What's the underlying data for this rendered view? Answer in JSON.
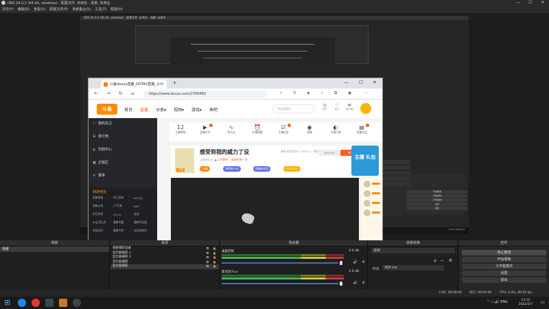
{
  "obs": {
    "title": "OBS 24.0.3 (64-bit, windows) - 配置文件: 未命名 - 场景: 未命名",
    "menu": [
      "文件(F)",
      "编辑(E)",
      "查看(V)",
      "配置文件(P)",
      "场景集合(S)",
      "工具(T)",
      "帮助(H)"
    ],
    "win_buttons": [
      "—",
      "☐",
      "✕"
    ]
  },
  "nested": {
    "title": "OBS 24.0.3 (64-bit, windows) - 配置文件: 未命名 - 场景: 未命名",
    "controls": [
      "开始推流",
      "开始录制",
      "工作室模式",
      "设置",
      "退出"
    ],
    "clock": "13:12\n2022/3/7"
  },
  "browser": {
    "tab_title": "斗鱼douyu直播_DOTA2直播_斗鱼",
    "tab_close": "✕",
    "new_tab": "+",
    "url": "https://www.douyu.com/2706482",
    "nav_icons": [
      "←",
      "→",
      "↻",
      "⌂"
    ],
    "win_buttons": [
      "—",
      "☐",
      "✕"
    ]
  },
  "douyu": {
    "logo": "斗鱼",
    "nav": [
      "首页",
      "直播",
      "分类▾",
      "视频▾",
      "游戏▾",
      "鱼吧"
    ],
    "search_placeholder": "Sky直播间",
    "header_icons": [
      {
        "glyph": "◷",
        "label": "历史"
      },
      {
        "glyph": "♡",
        "label": "关注"
      },
      {
        "glyph": "✉",
        "label": "客户端"
      }
    ],
    "sidebar": [
      {
        "icon": "♡",
        "label": "我的关注"
      },
      {
        "icon": "☰",
        "label": "排行榜"
      },
      {
        "icon": "◎",
        "label": "司鼎中心"
      },
      {
        "icon": "▦",
        "label": "正版区"
      },
      {
        "icon": "♕",
        "label": "赛事"
      }
    ],
    "sidebar_section_title": "网游竞技",
    "sidebar_grid": [
      "英雄联盟",
      "热门游戏",
      "DOTA2",
      "穿越火线",
      "CF手游",
      "DNF",
      "炉石传说",
      "CS:GO",
      "逆战",
      "lol云顶之弈",
      "魔兽争霸",
      "魔兽怀旧服",
      "永劫无间",
      "魔兽世界",
      "仙剑奇侠传"
    ],
    "icon_row": [
      {
        "glyph": "12",
        "label": "主播等级"
      },
      {
        "glyph": "▶",
        "label": "直播开关"
      },
      {
        "glyph": "∿",
        "label": "鱼丸回"
      },
      {
        "glyph": "⏰",
        "label": "开播提醒"
      },
      {
        "glyph": "☑",
        "label": "主播任务"
      },
      {
        "glyph": "◉",
        "label": "直播"
      },
      {
        "glyph": "◐",
        "label": "主播口碑"
      },
      {
        "glyph": "▤",
        "label": "直播作品"
      }
    ],
    "room": {
      "title": "感受到我的威力了没",
      "category": "举报   网游竞技 > DOTA2 > 德洋天梯",
      "avatar_level": "10级",
      "host": "斗鱼douyu",
      "hot": "216894",
      "rank_text": "周星榜第一名",
      "num": "231214",
      "follow": "关注",
      "tags": [
        "12级",
        "周榜前20名",
        "超级粉丝团",
        "300人以上"
      ]
    },
    "promo": "主播\n礼包"
  },
  "dock": {
    "scenes": {
      "title": "场景",
      "items": [
        "场景"
      ],
      "footer": [
        "+",
        "−",
        "∧",
        "∨"
      ]
    },
    "sources": {
      "title": "来源",
      "items": [
        "视频捕获设备",
        "显示器捕获 2",
        "显示器捕获 3",
        "显示器捕获",
        "显示器捕获"
      ],
      "visible_icon": "👁",
      "lock_icon": "🔒",
      "footer": [
        "+",
        "−",
        "⚙",
        "∧",
        "∨"
      ]
    },
    "mixer": {
      "title": "混音器",
      "channels": [
        {
          "name": "桌面音频",
          "db": "0.0 dB"
        },
        {
          "name": "麦克风/Aux",
          "db": "0.0 dB"
        }
      ],
      "mute_icon": "🔊",
      "gear_icon": "⚙"
    },
    "transitions": {
      "title": "场景转换",
      "selected": "淡出",
      "duration_label": "时长",
      "duration_value": "300 ms",
      "footer": [
        "+",
        "−",
        "⚙"
      ]
    },
    "controls": {
      "title": "控件",
      "buttons": [
        "停止推流",
        "开始录制",
        "工作室模式",
        "设置",
        "退出"
      ]
    }
  },
  "status": {
    "live": "LIVE: 00:00:00",
    "rec": "REC: 00:00:00",
    "cpu": "CPU: 0.4%, 60.00 fps"
  },
  "taskbar": {
    "tray": "^  ▭  🔊  ENG",
    "time": "13:12",
    "date": "2022/3/7",
    "notif": "▭"
  },
  "colors": {
    "accent": "#ff5d23",
    "douyu_orange": "#ff8a00",
    "obs_bg": "#1e1e1e"
  }
}
